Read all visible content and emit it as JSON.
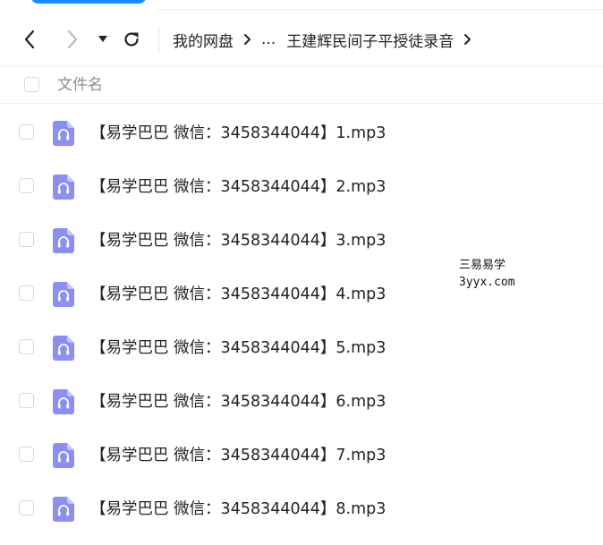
{
  "nav": {
    "back_icon": "chevron-left-icon",
    "forward_icon": "chevron-right-icon",
    "history_icon": "caret-down-icon",
    "refresh_icon": "refresh-icon"
  },
  "breadcrumb": {
    "root": "我的网盘",
    "ellipsis": "...",
    "current": "王建辉民间子平授徒录音"
  },
  "list_header": {
    "name_column": "文件名"
  },
  "files": [
    {
      "name": "【易学巴巴 微信：3458344044】1.mp3",
      "icon": "audio-file-icon"
    },
    {
      "name": "【易学巴巴 微信：3458344044】2.mp3",
      "icon": "audio-file-icon"
    },
    {
      "name": "【易学巴巴 微信：3458344044】3.mp3",
      "icon": "audio-file-icon"
    },
    {
      "name": "【易学巴巴 微信：3458344044】4.mp3",
      "icon": "audio-file-icon"
    },
    {
      "name": "【易学巴巴 微信：3458344044】5.mp3",
      "icon": "audio-file-icon"
    },
    {
      "name": "【易学巴巴 微信：3458344044】6.mp3",
      "icon": "audio-file-icon"
    },
    {
      "name": "【易学巴巴 微信：3458344044】7.mp3",
      "icon": "audio-file-icon"
    },
    {
      "name": "【易学巴巴 微信：3458344044】8.mp3",
      "icon": "audio-file-icon"
    }
  ],
  "watermark": {
    "line1": "三易易学",
    "line2": "3yyx.com"
  },
  "colors": {
    "accent": "#1e88ff",
    "audio_icon": "#8b8ff2",
    "text": "#222222",
    "muted_text": "#8a8e96"
  }
}
